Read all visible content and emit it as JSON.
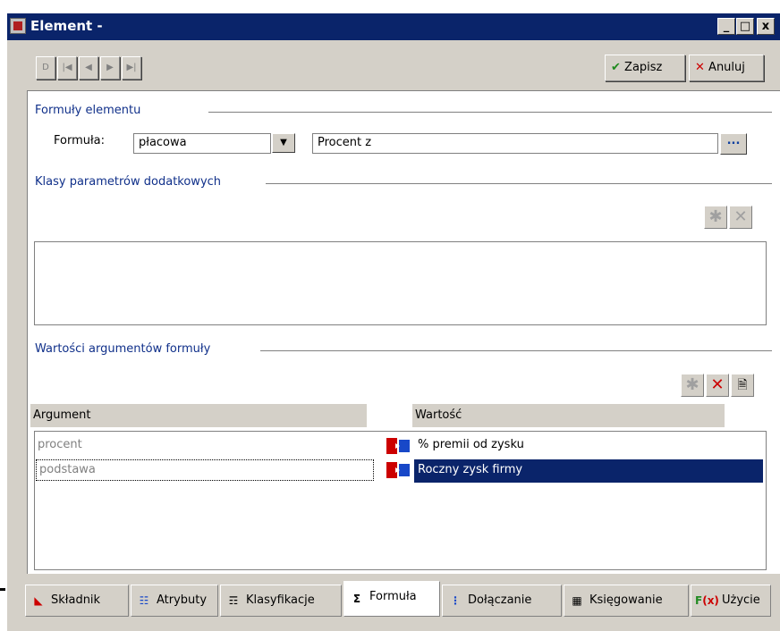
{
  "window": {
    "title": "Element -",
    "controls": {
      "minimize": "_",
      "maximize": "□",
      "close": "x"
    }
  },
  "toolbar": {
    "nav_icons": [
      "new-record-icon",
      "first-record-icon",
      "previous-record-icon",
      "next-record-icon",
      "last-record-icon"
    ],
    "save_label": "Zapisz",
    "cancel_label": "Anuluj"
  },
  "formula_section": {
    "heading": "Formuły elementu",
    "formula_label": "Formuła:",
    "formula_type_value": "płacowa",
    "formula_name_value": "Procent z",
    "browse_label": "..."
  },
  "classes_section": {
    "heading": "Klasy parametrów dodatkowych"
  },
  "arguments_section": {
    "heading": "Wartości argumentów formuły",
    "columns": [
      "Argument",
      "Wartość"
    ],
    "rows": [
      {
        "argument": "procent",
        "value": "% premii od zysku",
        "selected": false
      },
      {
        "argument": "podstawa",
        "value": "Roczny zysk firmy",
        "selected": true
      }
    ]
  },
  "tabs": [
    {
      "label": "Składnik",
      "icon": "component-icon",
      "active": false
    },
    {
      "label": "Atrybuty",
      "icon": "attributes-icon",
      "active": false
    },
    {
      "label": "Klasyfikacje",
      "icon": "classification-icon",
      "active": false
    },
    {
      "label": "Formuła",
      "icon": "sigma-icon",
      "active": true
    },
    {
      "label": "Dołączanie",
      "icon": "attach-icon",
      "active": false
    },
    {
      "label": "Księgowanie",
      "icon": "accounting-icon",
      "active": false
    },
    {
      "label": "Użycie",
      "icon": "function-icon",
      "active": false
    }
  ],
  "colors": {
    "titlebar": "#0a246a",
    "selection": "#0a246a",
    "section_heading": "#10308a",
    "cancel_x": "#cc0000",
    "save_check": "#1e8a1e"
  }
}
